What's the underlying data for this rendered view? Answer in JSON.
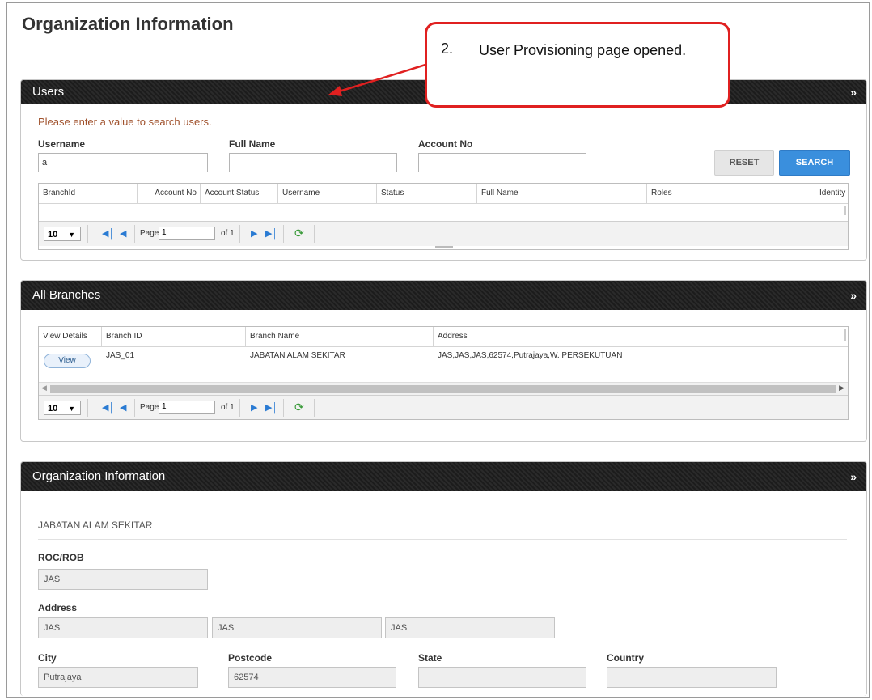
{
  "page_title": "Organization Information",
  "callout": {
    "number": "2.",
    "text": "User Provisioning page opened."
  },
  "users_panel": {
    "title": "Users",
    "hint": "Please enter a value to search users.",
    "username_label": "Username",
    "username_value": "a",
    "fullname_label": "Full Name",
    "fullname_value": "",
    "account_label": "Account No",
    "account_value": "",
    "reset_label": "RESET",
    "search_label": "SEARCH",
    "columns": [
      "BranchId",
      "Account No",
      "Account Status",
      "Username",
      "Status",
      "Full Name",
      "Roles",
      "Identity"
    ],
    "pager": {
      "page_size": "10",
      "page_label": "Page",
      "page_value": "1",
      "of_label": "of 1"
    }
  },
  "branches_panel": {
    "title": "All Branches",
    "columns": [
      "View Details",
      "Branch ID",
      "Branch Name",
      "Address"
    ],
    "rows": [
      {
        "view": "View",
        "branch_id": "JAS_01",
        "branch_name": "JABATAN ALAM SEKITAR",
        "address": "JAS,JAS,JAS,62574,Putrajaya,W. PERSEKUTUAN"
      }
    ],
    "pager": {
      "page_size": "10",
      "page_label": "Page",
      "page_value": "1",
      "of_label": "of 1"
    }
  },
  "org_panel": {
    "title": "Organization Information",
    "org_name": "JABATAN ALAM SEKITAR",
    "roc_label": "ROC/ROB",
    "roc_value": "JAS",
    "address_label": "Address",
    "address1": "JAS",
    "address2": "JAS",
    "address3": "JAS",
    "city_label": "City",
    "city_value": "Putrajaya",
    "postcode_label": "Postcode",
    "postcode_value": "62574",
    "state_label": "State",
    "state_value": "",
    "country_label": "Country",
    "country_value": ""
  },
  "icons": {
    "collapse": "double-chevron-down-icon",
    "first": "first-page-icon",
    "prev": "prev-page-icon",
    "next": "next-page-icon",
    "last": "last-page-icon",
    "refresh": "refresh-icon",
    "dropdown": "dropdown-arrow-icon"
  },
  "colors": {
    "header_bg": "#1f1f1f",
    "hint": "#a0522d",
    "search_btn": "#3a8fdd",
    "callout_border": "#e02020",
    "pager_icon": "#2a7bd3"
  }
}
